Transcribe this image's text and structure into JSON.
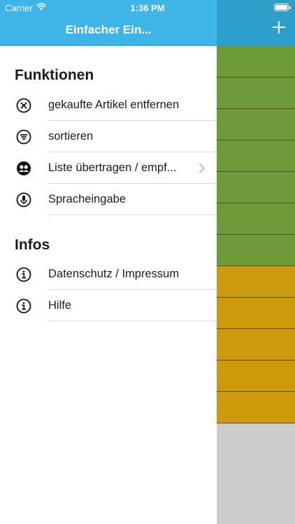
{
  "status_bar": {
    "carrier": "Carrier",
    "time": "1:36 PM"
  },
  "header": {
    "title": "Einfacher Ein..."
  },
  "functions": {
    "heading": "Funktionen",
    "items": [
      {
        "label": "gekaufte Artikel entfernen",
        "icon": "x-circle-icon"
      },
      {
        "label": "sortieren",
        "icon": "filter-icon"
      },
      {
        "label": "Liste übertragen / empf...",
        "icon": "share-people-icon"
      },
      {
        "label": "Spracheingabe",
        "icon": "microphone-icon"
      }
    ]
  },
  "infos": {
    "heading": "Infos",
    "items": [
      {
        "label": "Datenschutz / Impressum",
        "icon": "info-icon"
      },
      {
        "label": "Hilfe",
        "icon": "info-icon"
      }
    ]
  },
  "background_list": {
    "row_colors": [
      "#6f9a3a",
      "#6f9a3a",
      "#6f9a3a",
      "#6f9a3a",
      "#6f9a3a",
      "#6f9a3a",
      "#6f9a3a",
      "#cc9a0a",
      "#cc9a0a",
      "#cc9a0a",
      "#cc9a0a",
      "#cc9a0a"
    ],
    "header_color": "#2e9ecb",
    "accent_color": "#3db5e6"
  }
}
